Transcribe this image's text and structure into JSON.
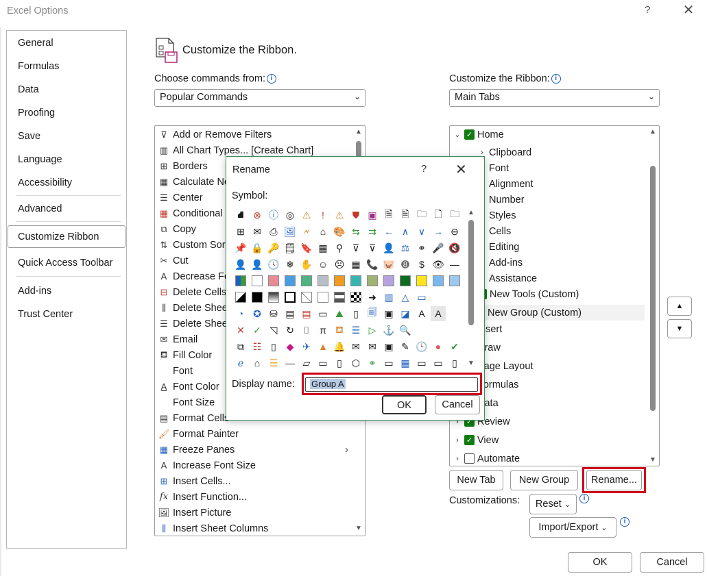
{
  "window": {
    "title": "Excel Options",
    "help": "?",
    "close": "✕"
  },
  "nav": {
    "items": [
      "General",
      "Formulas",
      "Data",
      "Proofing",
      "Save",
      "Language",
      "Accessibility",
      "Advanced",
      "Customize Ribbon",
      "Quick Access Toolbar",
      "Add-ins",
      "Trust Center"
    ],
    "selected": "Customize Ribbon"
  },
  "header": {
    "title": "Customize the Ribbon."
  },
  "left_panel": {
    "label": "Choose commands from:",
    "combo_value": "Popular Commands",
    "commands": [
      "Add or Remove Filters",
      "All Chart Types... [Create Chart]",
      "Borders",
      "Calculate Now",
      "Center",
      "Conditional Formatting",
      "Copy",
      "Custom Sort...",
      "Cut",
      "Decrease Font Size",
      "Delete Cells...",
      "Delete Sheet Columns",
      "Delete Sheet Rows",
      "Email",
      "Fill Color",
      "Font",
      "Font Color",
      "Font Size",
      "Format Cells",
      "Format Painter",
      "Freeze Panes",
      "Increase Font Size",
      "Insert Cells...",
      "Insert Function...",
      "Insert Picture",
      "Insert Sheet Columns"
    ]
  },
  "right_panel": {
    "label": "Customize the Ribbon:",
    "combo_value": "Main Tabs",
    "tree": {
      "home": "Home",
      "groups": [
        "Clipboard",
        "Font",
        "Alignment",
        "Number",
        "Styles",
        "Cells",
        "Editing",
        "Add-ins",
        "Assistance"
      ],
      "new_tab": "New Tools (Custom)",
      "new_group": "New Group (Custom)",
      "tabs_after": [
        "Insert",
        "Draw",
        "Page Layout",
        "Formulas",
        "Data",
        "Review",
        "View",
        "Automate"
      ]
    },
    "buttons": {
      "new_tab": "New Tab",
      "new_group": "New Group",
      "rename": "Rename..."
    },
    "customizations_label": "Customizations:",
    "reset": "Reset",
    "import_export": "Import/Export",
    "move_up": "▲",
    "move_down": "▼"
  },
  "footer": {
    "ok": "OK",
    "cancel": "Cancel"
  },
  "dialog": {
    "title": "Rename",
    "help": "?",
    "close": "✕",
    "symbol_label": "Symbol:",
    "display_name_label": "Display name:",
    "display_name_value": "Group A",
    "ok": "OK",
    "cancel": "Cancel",
    "symbols": [
      [
        "⛘",
        "⊗",
        "ⓘ",
        "◎",
        "⚠",
        "!",
        "⚠",
        "⛊",
        "▣",
        "🗎",
        "🗎",
        "🗀",
        "🗋",
        "🗀"
      ],
      [
        "⊞",
        "✉",
        "⎙",
        "🖼",
        "🗲",
        "🎨",
        "⇆",
        "⇉",
        "←",
        "∧",
        "∨",
        "→",
        "⊖"
      ],
      [
        "📌",
        "🔒",
        "🔑",
        "🗒",
        "🔖",
        "▦",
        "⊽",
        "⊽",
        "👤",
        "⚖",
        "⚭",
        "🎤",
        "🔇"
      ],
      [
        "👤",
        "👤",
        "🕓",
        "❄",
        "✋",
        "☺",
        "☹",
        "▦",
        "📞",
        "🐷",
        "➑",
        "$",
        "👁",
        "—"
      ],
      [
        "sw",
        "sw",
        "sw",
        "sw",
        "sw",
        "sw",
        "sw",
        "sw",
        "sw",
        "sw",
        "sw",
        "sw",
        "sw",
        "sw"
      ],
      [
        "◪",
        "■",
        "▤",
        "□",
        "◺",
        "□",
        "▤",
        "▩",
        "➜",
        "▥",
        "△",
        "▭"
      ],
      [
        "◔",
        "✪",
        "⛁",
        "▤",
        "▤",
        "▭",
        "⛰",
        "▯",
        "🗐",
        "▣",
        "◪",
        "A",
        "A"
      ],
      [
        "✕",
        "✓",
        "◹",
        "↻",
        "⌷",
        "π",
        "⛾",
        "☰",
        "▷",
        "⚓",
        "🔍"
      ],
      [
        "⧉",
        "☷",
        "▯",
        "◆",
        "✈",
        "▲",
        "🔔",
        "✉",
        "✉",
        "▣",
        "✎",
        "🕒",
        "●",
        "✔"
      ],
      [
        "ℯ",
        "⌂",
        "☰",
        "—",
        "▱",
        "▭",
        "▯",
        "⬡",
        "▭",
        "▦",
        "▭",
        "▭",
        "▯"
      ]
    ]
  }
}
